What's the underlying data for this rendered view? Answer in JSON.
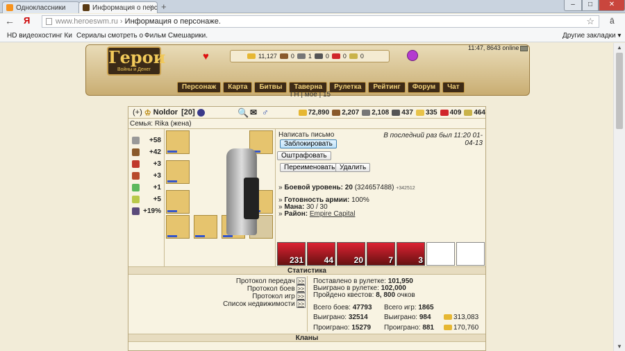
{
  "browser": {
    "tabs": [
      {
        "title": "Одноклассники",
        "active": false
      },
      {
        "title": "Информация о персс",
        "active": true
      }
    ],
    "url_host": "www.heroeswm.ru",
    "url_sep": "›",
    "url_title": "Информация о персонаже.",
    "bookmarks": [
      "HD видеохостинг Ки",
      "Сериалы смотреть о",
      "Фильм Смешарики."
    ],
    "other_bookmarks": "Другие закладки ▾"
  },
  "header": {
    "logo_title": "Герои",
    "logo_subtitle": "Войны и Денег",
    "time_online": "11:47, 8643 online",
    "resources": [
      "11,127",
      "0",
      "1",
      "0",
      "0",
      "0"
    ],
    "menu": [
      "Персонаж",
      "Карта",
      "Битвы",
      "Таверна",
      "Рулетка",
      "Рейтинг",
      "Форум",
      "Чат"
    ],
    "sub": "ГН | мое | 15"
  },
  "player": {
    "plus": "(+)",
    "name": "Noldor",
    "level": "[20]",
    "family": "Семья: Rika (жена)",
    "resources": [
      {
        "value": "72,890",
        "color": "#e6b733"
      },
      {
        "value": "2,207",
        "color": "#8a5a2b"
      },
      {
        "value": "2,108",
        "color": "#777777"
      },
      {
        "value": "437",
        "color": "#555555"
      },
      {
        "value": "335",
        "color": "#e8c34a"
      },
      {
        "value": "409",
        "color": "#d0262a"
      },
      {
        "value": "464",
        "color": "#c9b34a"
      }
    ]
  },
  "stats": [
    {
      "icon": "swords-icon",
      "value": "+58",
      "color": "#999999"
    },
    {
      "icon": "shield-icon",
      "value": "+42",
      "color": "#8a5a2b"
    },
    {
      "icon": "wand-icon",
      "value": "+3",
      "color": "#c0392b"
    },
    {
      "icon": "book-icon",
      "value": "+3",
      "color": "#b84a2a"
    },
    {
      "icon": "rainbow-icon",
      "value": "+1",
      "color": "#5cb85c"
    },
    {
      "icon": "horseshoe-icon",
      "value": "+5",
      "color": "#b9c94a"
    },
    {
      "icon": "potion-icon",
      "value": "+19%",
      "color": "#5a4a7a"
    }
  ],
  "actions": {
    "write": "Написать письмо",
    "block": "Заблокировать",
    "fine": "Оштрафовать",
    "rename": "Переименовать",
    "delete": "Удалить",
    "last_visit": "В последний раз был 11:20 01-04-13"
  },
  "info": {
    "combat_label": "Боевой уровень:",
    "combat_level": "20",
    "combat_exp": "(324657488)",
    "combat_extra": "+342512",
    "army_label": "Готовность армии:",
    "army_value": "100%",
    "mana_label": "Мана:",
    "mana_value": "30 / 30",
    "district_label": "Район:",
    "district_value": "Empire Capital"
  },
  "army": [
    "231",
    "44",
    "20",
    "7",
    "3",
    "",
    ""
  ],
  "sections": {
    "statistics": "Статистика",
    "clans": "Кланы"
  },
  "protocols": [
    {
      "label": "Протокол передач",
      "link": ">>"
    },
    {
      "label": "Протокол боев",
      "link": ">>"
    },
    {
      "label": "Протокол игр",
      "link": ">>"
    },
    {
      "label": "Список недвижимости",
      "link": ">>"
    }
  ],
  "statistics": {
    "roulette_bet_label": "Поставлено в рулетке:",
    "roulette_bet": "101,950",
    "roulette_won_label": "Выиграно в рулетке:",
    "roulette_won": "102,000",
    "quests_label": "Пройдено квестов:",
    "quests": "8, 800",
    "quests_unit": "очков",
    "battles_label": "Всего боев:",
    "battles": "47793",
    "battles_won_label": "Выиграно:",
    "battles_won": "32514",
    "battles_lost_label": "Проиграно:",
    "battles_lost": "15279",
    "games_label": "Всего игр:",
    "games": "1865",
    "games_won_label": "Выиграно:",
    "games_won": "984",
    "games_lost_label": "Проиграно:",
    "games_lost": "881",
    "gold_won": "313,083",
    "gold_lost": "170,760"
  }
}
